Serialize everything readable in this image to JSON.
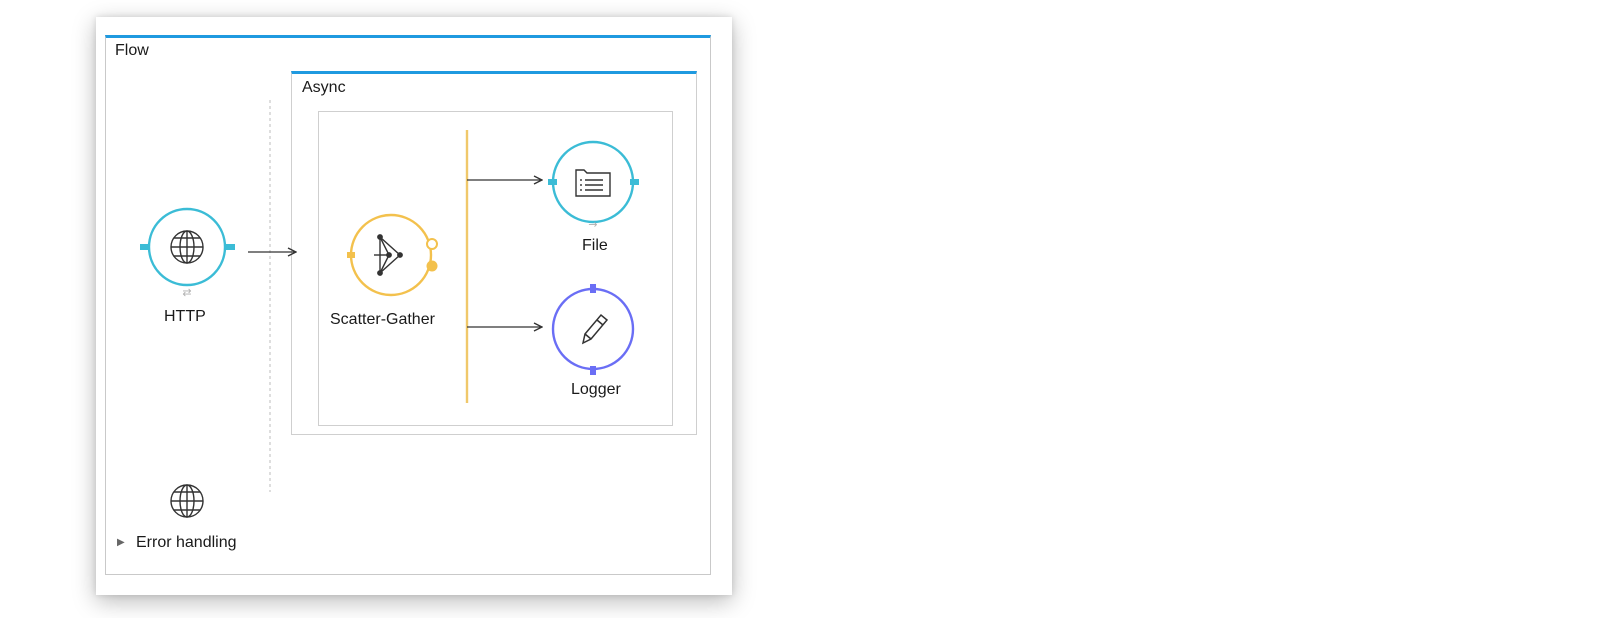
{
  "flow": {
    "title": "Flow",
    "source": {
      "label": "HTTP",
      "icon": "globe-icon"
    },
    "async": {
      "title": "Async",
      "router": {
        "label": "Scatter-Gather",
        "icon": "scatter-gather-icon"
      },
      "routes": [
        {
          "label": "File",
          "icon": "file-icon"
        },
        {
          "label": "Logger",
          "icon": "pencil-icon"
        }
      ]
    },
    "error_handling": {
      "label": "Error handling",
      "icon": "globe-icon"
    }
  },
  "colors": {
    "flow_border": "#1f9ae0",
    "http": "#3bbcd6",
    "scatter_gather": "#f3c14d",
    "file": "#3bbcd6",
    "logger": "#6a6ef5",
    "router_line": "#f0c86a"
  }
}
